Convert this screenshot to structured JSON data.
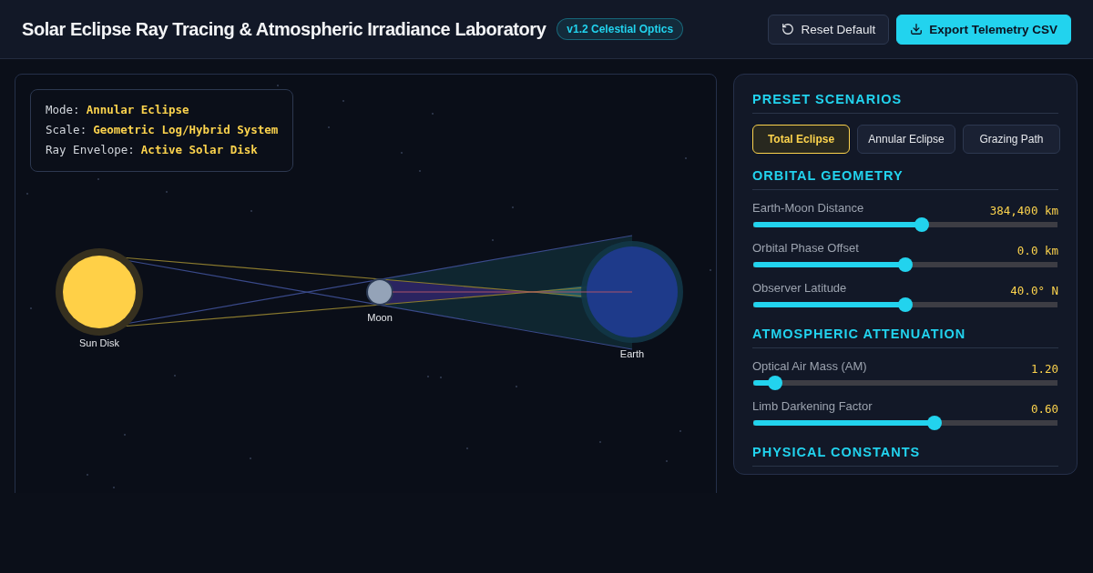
{
  "header": {
    "title": "Solar Eclipse Ray Tracing & Atmospheric Irradiance Laboratory",
    "badge": "v1.2 Celestial Optics",
    "buttons": [
      {
        "kind": "reset",
        "label": "Reset Default"
      },
      {
        "kind": "export",
        "label": "Export Telemetry CSV"
      }
    ]
  },
  "viewport": {
    "info": [
      {
        "label": "Mode:",
        "value": "Annular Eclipse"
      },
      {
        "label": "Scale:",
        "value": "Geometric Log/Hybrid System"
      },
      {
        "label": "Ray Envelope:",
        "value": "Active Solar Disk"
      }
    ],
    "bodies": [
      {
        "kind": "sun",
        "label": "Sun Disk"
      },
      {
        "kind": "moon",
        "label": "Moon"
      },
      {
        "kind": "earth",
        "label": "Earth"
      }
    ]
  },
  "controls": {
    "sections": [
      {
        "title": "PRESET SCENARIOS",
        "presets": [
          {
            "label": "Total Eclipse",
            "selected": true
          },
          {
            "label": "Annular Eclipse",
            "selected": false
          },
          {
            "label": "Grazing Path",
            "selected": false
          }
        ]
      },
      {
        "title": "ORBITAL GEOMETRY",
        "sliders": [
          {
            "label": "Earth-Moon Distance",
            "reading": "384,400 km",
            "level": 0.556
          },
          {
            "label": "Orbital Phase Offset",
            "reading": "0.0 km",
            "level": 0.5
          },
          {
            "label": "Observer Latitude",
            "reading": "40.0° N",
            "level": 0.5
          }
        ]
      },
      {
        "title": "ATMOSPHERIC ATTENUATION",
        "sliders": [
          {
            "label": "Optical Air Mass (AM)",
            "reading": "1.20",
            "level": 0.05
          },
          {
            "label": "Limb Darkening Factor",
            "reading": "0.60",
            "level": 0.6
          }
        ]
      },
      {
        "title": "PHYSICAL CONSTANTS"
      }
    ]
  }
}
